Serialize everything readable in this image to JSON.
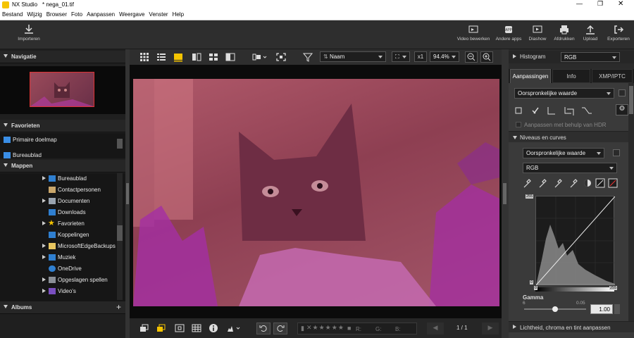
{
  "window": {
    "app": "NX Studio",
    "file": "* nega_01.tif"
  },
  "menu": [
    "Bestand",
    "Wijzig",
    "Browser",
    "Foto",
    "Aanpassen",
    "Weergave",
    "Venster",
    "Help"
  ],
  "toolbar": {
    "import": "Importeren",
    "video_edit": "Video bewerken",
    "other_apps": "Andere apps",
    "slideshow": "Diashow",
    "print": "Afdrukken",
    "upload": "Upload",
    "export": "Exporteren"
  },
  "left": {
    "navigation": "Navigatie",
    "favorites": "Favorieten",
    "fav_items": [
      "Primaire doelmap",
      "Bureaublad"
    ],
    "folders": "Mappen",
    "folder_items": [
      "Bureaublad",
      "Contactpersonen",
      "Documenten",
      "Downloads",
      "Favorieten",
      "Koppelingen",
      "MicrosoftEdgeBackups",
      "Muziek",
      "OneDrive",
      "Opgeslagen spellen",
      "Video's"
    ],
    "albums": "Albums",
    "albums_add": "+"
  },
  "viewer": {
    "sort": "Naam",
    "zoom_x": "x1",
    "zoom": "94.4%",
    "page": "1 / 1",
    "rgb_r": "R:",
    "rgb_g": "G:",
    "rgb_b": "B:"
  },
  "right": {
    "histogram": "Histogram",
    "histo_channel": "RGB",
    "tabs": [
      "Aanpassingen",
      "Info",
      "XMP/IPTC"
    ],
    "preset": "Oorspronkelijke waarde",
    "hdr": "Aanpassen met behulp van HDR",
    "levels": "Niveaus en curves",
    "levels_preset": "Oorspronkelijke waarde",
    "channel": "RGB",
    "val_255_top": "255",
    "val_0_left": "0",
    "val_0_bottom": "0",
    "val_255_bottom": "255",
    "gamma": "Gamma",
    "gamma_min": "6",
    "gamma_mid": "0.05",
    "gamma_value": "1.00",
    "gamma_level": 0.5,
    "lightness": "Lichtheid, chroma en tint aanpassen"
  },
  "colors": {
    "accent": "#f5c400",
    "tab_active": "#3a3a3a",
    "image_tint": "#a0525e"
  }
}
